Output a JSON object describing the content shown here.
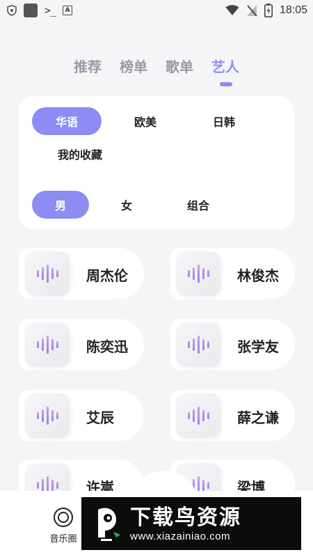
{
  "status_bar": {
    "time": "18:05",
    "left_icons": [
      "shield-icon",
      "app-square-icon",
      "terminal-icon",
      "font-a-icon"
    ],
    "right_icons": [
      "wifi-icon",
      "no-signal-icon",
      "battery-charging-icon"
    ]
  },
  "tabs": [
    {
      "label": "推荐",
      "active": false
    },
    {
      "label": "榜单",
      "active": false
    },
    {
      "label": "歌单",
      "active": false
    },
    {
      "label": "艺人",
      "active": true
    }
  ],
  "filters": {
    "region": [
      {
        "label": "华语",
        "selected": true
      },
      {
        "label": "欧美",
        "selected": false
      },
      {
        "label": "日韩",
        "selected": false
      },
      {
        "label": "我的收藏",
        "selected": false
      }
    ],
    "gender": [
      {
        "label": "男",
        "selected": true
      },
      {
        "label": "女",
        "selected": false
      },
      {
        "label": "组合",
        "selected": false
      }
    ]
  },
  "artists": [
    {
      "name": "周杰伦"
    },
    {
      "name": "林俊杰"
    },
    {
      "name": "陈奕迅"
    },
    {
      "name": "张学友"
    },
    {
      "name": "艾辰"
    },
    {
      "name": "薛之谦"
    },
    {
      "name": "许嵩"
    },
    {
      "name": "梁博"
    }
  ],
  "bottom_nav": {
    "items": [
      {
        "label": "音乐圈",
        "icon": "vinyl-icon"
      }
    ]
  },
  "watermark": {
    "title": "下载鸟资源",
    "url": "www.xiazainiao.com"
  },
  "colors": {
    "accent": "#8c8cf2",
    "background": "#f5f5f7",
    "wave_gradient": [
      "#c9a0e0",
      "#9d7fe8"
    ]
  }
}
